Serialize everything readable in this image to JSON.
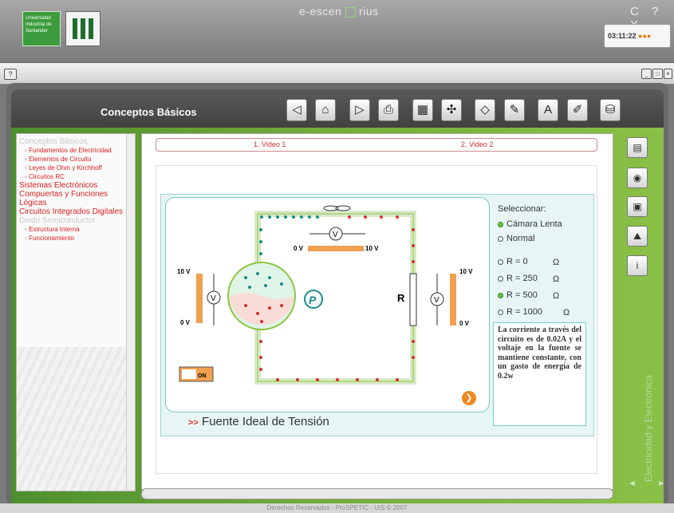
{
  "app": {
    "brand": "e-escen",
    "brand_suffix": "rius",
    "window_controls": "C ? X"
  },
  "university": {
    "logo_text": "Universidad Industrial de Santander"
  },
  "clock": {
    "time": "03:11:22"
  },
  "toolbar": {
    "help": "?"
  },
  "header": {
    "title": "Conceptos Básicos"
  },
  "nav_buttons": [
    "back",
    "home",
    "forward",
    "print",
    "calculator",
    "network",
    "eraser",
    "edit",
    "text",
    "pen",
    "save"
  ],
  "sidebar": {
    "items": [
      {
        "label": "Conceptos Básicos",
        "level": "top",
        "dim": true
      },
      {
        "label": "Fundamentos de Electricidad",
        "level": "sub"
      },
      {
        "label": "Elementos de Circuito",
        "level": "sub"
      },
      {
        "label": "Leyes de Ohm y Kirchhoff",
        "level": "sub"
      },
      {
        "label": "Circuitos RC",
        "level": "sub"
      },
      {
        "label": "Sistemas Electrónicos",
        "level": "top"
      },
      {
        "label": "Compuertas y Funciones Lógicas",
        "level": "top"
      },
      {
        "label": "Circuitos Integrados Digitales",
        "level": "top"
      },
      {
        "label": "Diodo Semiconductor",
        "level": "top",
        "dim": true
      },
      {
        "label": "Estructura Interna",
        "level": "sub"
      },
      {
        "label": "Funcionamiento",
        "level": "sub"
      }
    ]
  },
  "tabs": [
    "1. Video 1",
    "2. Video 2"
  ],
  "simulation": {
    "title": "Fuente Ideal de Tensión",
    "title_arrow": ">>",
    "labels": {
      "v_left_top": "10 V",
      "v_left_bottom": "0 V",
      "v_top_left": "0 V",
      "v_top_right": "10 V",
      "v_right_top": "10 V",
      "v_right_bottom": "0 V",
      "resistor": "R",
      "meter": "V",
      "power": "P",
      "switch": "ON"
    },
    "select_label": "Seleccionar:",
    "speed_options": [
      {
        "label": "Cámara Lenta",
        "selected": true
      },
      {
        "label": "Normal",
        "selected": false
      }
    ],
    "r_options": [
      {
        "label": "R = 0",
        "unit": "Ω",
        "selected": false
      },
      {
        "label": "R = 250",
        "unit": "Ω",
        "selected": false
      },
      {
        "label": "R = 500",
        "unit": "Ω",
        "selected": true
      },
      {
        "label": "R = 1000",
        "unit": "Ω",
        "selected": false
      }
    ],
    "description": "La corriente a través del circuito es de 0.02A y el voltaje en la fuente se mantiene constante, con un gasto de energía de 0.2w"
  },
  "side_label": "Electricidad y Electrónica",
  "footer": "Derechos Reservados - ProSPETIC - UIS © 2007",
  "colors": {
    "accent_red": "#d91f1f",
    "green": "#6cc04a",
    "teal": "#7ec8c2",
    "orange": "#f08a20"
  }
}
